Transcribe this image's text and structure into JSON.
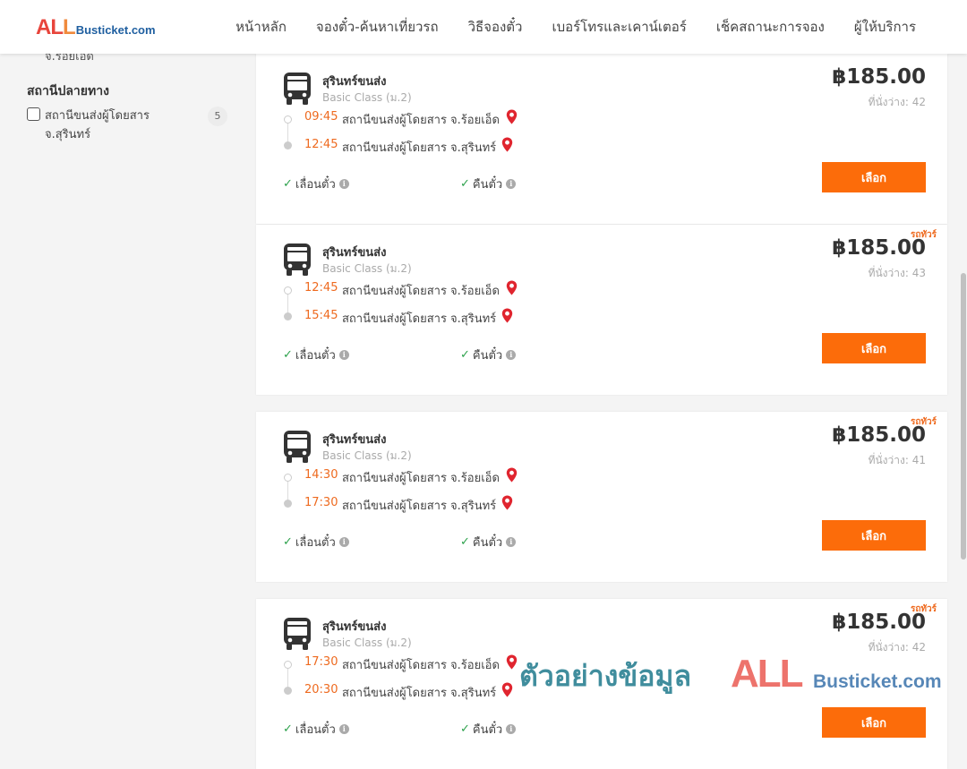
{
  "logo": {
    "all": "ALL",
    "a": "A",
    "l1": "L",
    "l2": "L",
    "busticket": "Busticket.com"
  },
  "nav": [
    "หน้าหลัก",
    "จองตั๋ว-ค้นหาเที่ยวรถ",
    "วิธีจองตั๋ว",
    "เบอร์โทรและเคาน์เตอร์",
    "เช็คสถานะการจอง",
    "ผู้ให้บริการ"
  ],
  "sidebar": {
    "cut_text": "จ.ร้อยเอ็ด",
    "destination_title": "สถานีปลายทาง",
    "option": {
      "label": "สถานีขนส่งผู้โดยสาร จ.สุรินทร์",
      "count": "5",
      "checked": false
    }
  },
  "trips": [
    {
      "operator": "สุรินทร์ขนส่ง",
      "class": "Basic Class (ม.2)",
      "tag": "",
      "price": "฿185.00",
      "seats": "ที่นั่งว่าง: 42",
      "depart_time": "09:45",
      "depart_station": "สถานีขนส่งผู้โดยสาร จ.ร้อยเอ็ด",
      "arrive_time": "12:45",
      "arrive_station": "สถานีขนส่งผู้โดยสาร จ.สุรินทร์",
      "feature1": "เลื่อนตั๋ว",
      "feature2": "คืนตั๋ว",
      "button": "เลือก"
    },
    {
      "operator": "สุรินทร์ขนส่ง",
      "class": "Basic Class (ม.2)",
      "tag": "รถทัวร์",
      "price": "฿185.00",
      "seats": "ที่นั่งว่าง: 43",
      "depart_time": "12:45",
      "depart_station": "สถานีขนส่งผู้โดยสาร จ.ร้อยเอ็ด",
      "arrive_time": "15:45",
      "arrive_station": "สถานีขนส่งผู้โดยสาร จ.สุรินทร์",
      "feature1": "เลื่อนตั๋ว",
      "feature2": "คืนตั๋ว",
      "button": "เลือก"
    },
    {
      "operator": "สุรินทร์ขนส่ง",
      "class": "Basic Class (ม.2)",
      "tag": "รถทัวร์",
      "price": "฿185.00",
      "seats": "ที่นั่งว่าง: 41",
      "depart_time": "14:30",
      "depart_station": "สถานีขนส่งผู้โดยสาร จ.ร้อยเอ็ด",
      "arrive_time": "17:30",
      "arrive_station": "สถานีขนส่งผู้โดยสาร จ.สุรินทร์",
      "feature1": "เลื่อนตั๋ว",
      "feature2": "คืนตั๋ว",
      "button": "เลือก"
    },
    {
      "operator": "สุรินทร์ขนส่ง",
      "class": "Basic Class (ม.2)",
      "tag": "รถทัวร์",
      "price": "฿185.00",
      "seats": "ที่นั่งว่าง: 42",
      "depart_time": "17:30",
      "depart_station": "สถานีขนส่งผู้โดยสาร จ.ร้อยเอ็ด",
      "arrive_time": "20:30",
      "arrive_station": "สถานีขนส่งผู้โดยสาร จ.สุรินทร์",
      "feature1": "เลื่อนตั๋ว",
      "feature2": "คืนตั๋ว",
      "button": "เลือก"
    }
  ],
  "watermark": {
    "thai": "ตัวอย่างข้อมูล",
    "all": "ALL",
    "busticket": "Busticket.com"
  },
  "icons": {
    "bus": "bus-icon",
    "pin": "map-pin-icon",
    "check": "check-icon",
    "info": "info-icon"
  },
  "colors": {
    "accent": "#fc6c0a",
    "time": "#ee6a1f",
    "check": "#2ea24d",
    "pin": "#e0252f",
    "logo_red": "#e8453c",
    "logo_blue": "#1f5fa0"
  }
}
